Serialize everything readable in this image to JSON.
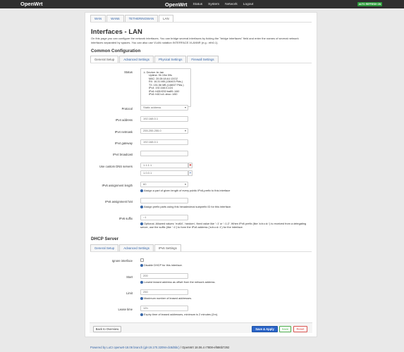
{
  "topbar": {
    "brand": "OpenWrt",
    "title": "OpenWrt",
    "menu": [
      "Status",
      "System",
      "Network",
      "Logout"
    ],
    "badge": "AUTO REFRESH ON"
  },
  "iface_tabs": [
    "WAN",
    "WAN6",
    "TETHERINGWAN",
    "LAN"
  ],
  "page": {
    "title": "Interfaces - LAN",
    "description": "On this page you can configure the network interfaces. You can bridge several interfaces by ticking the \"bridge interfaces\" field and enter the names of several network interfaces separated by spaces. You can also use VLAN notation INTERFACE.VLANNR (e.g.: eth0.1)."
  },
  "common": {
    "heading": "Common Configuration",
    "tabs": [
      "General Setup",
      "Advanced Settings",
      "Physical Settings",
      "Firewall Settings"
    ]
  },
  "status": {
    "label": "Status",
    "device": "Device: br-lan",
    "lines": [
      "Uptime: 9h 19m 59s",
      "MAC: 20:28:18:A1:13:D2",
      "RX: 16.31 MB (136403 Pkts.)",
      "TX: 151.56 MB (148037 Pkts.)",
      "IPv4: 192.168.0.1/24",
      "IPv6: fd28:f202:ba89::1/60",
      "IPv6: fd10:c4::cbcc::1/60"
    ]
  },
  "fields": {
    "protocol": {
      "label": "Protocol",
      "value": "Static address"
    },
    "ipv4_address": {
      "label": "IPv4 address",
      "value": "192.168.0.1"
    },
    "ipv4_netmask": {
      "label": "IPv4 netmask",
      "value": "255.255.255.0"
    },
    "ipv4_gateway": {
      "label": "IPv4 gateway",
      "value": "192.168.0.1"
    },
    "ipv4_broadcast": {
      "label": "IPv4 broadcast",
      "value": ""
    },
    "dns": {
      "label": "Use custom DNS servers",
      "values": [
        "1.1.1.1",
        "1.0.0.1"
      ]
    },
    "ipv6_assign_len": {
      "label": "IPv6 assignment length",
      "value": "60",
      "help": "Assign a part of given length of every public IPv6-prefix to this interface"
    },
    "ipv6_assign_hint": {
      "label": "IPv6 assignment hint",
      "value": "",
      "help": "Assign prefix parts using this hexadecimal subprefix ID for this interface."
    },
    "ipv6_suffix": {
      "label": "IPv6 suffix",
      "value": "::1",
      "help": "Optional. Allowed values: 'eui64', 'random', fixed value like '::1' or '::1:2'. When IPv6 prefix (like 'a:b:c:d::') is received from a delegating server, use the suffix (like '::1') to form the IPv6 address ('a:b:c:d::1') for the interface."
    }
  },
  "dhcp": {
    "heading": "DHCP Server",
    "tabs": [
      "General Setup",
      "Advanced Settings",
      "IPv6 Settings"
    ],
    "ignore": {
      "label": "Ignore interface",
      "help": "Disable DHCP for this interface."
    },
    "start": {
      "label": "Start",
      "value": "200",
      "help": "Lowest leased address as offset from the network address."
    },
    "limit": {
      "label": "Limit",
      "value": "250",
      "help": "Maximum number of leased addresses."
    },
    "lease": {
      "label": "Lease time",
      "value": "12h",
      "help": "Expiry time of leased addresses, minimum is 2 minutes (2m)."
    }
  },
  "buttons": {
    "back": "Back to Overview",
    "save_apply": "Save & Apply",
    "save": "Save",
    "reset": "Reset"
  },
  "footer": {
    "link": "Powered by LuCI openwrt-18.06 branch (git-19.170.32094-dc8d5bc)",
    "rest": " / OpenWrt 18.06.4 r7808-ef686b7292"
  },
  "colors": {
    "topbar": "#2f2f2f",
    "link": "#3565a8",
    "primary": "#2a64c8",
    "success": "#5cb85c",
    "danger": "#d9534f"
  }
}
